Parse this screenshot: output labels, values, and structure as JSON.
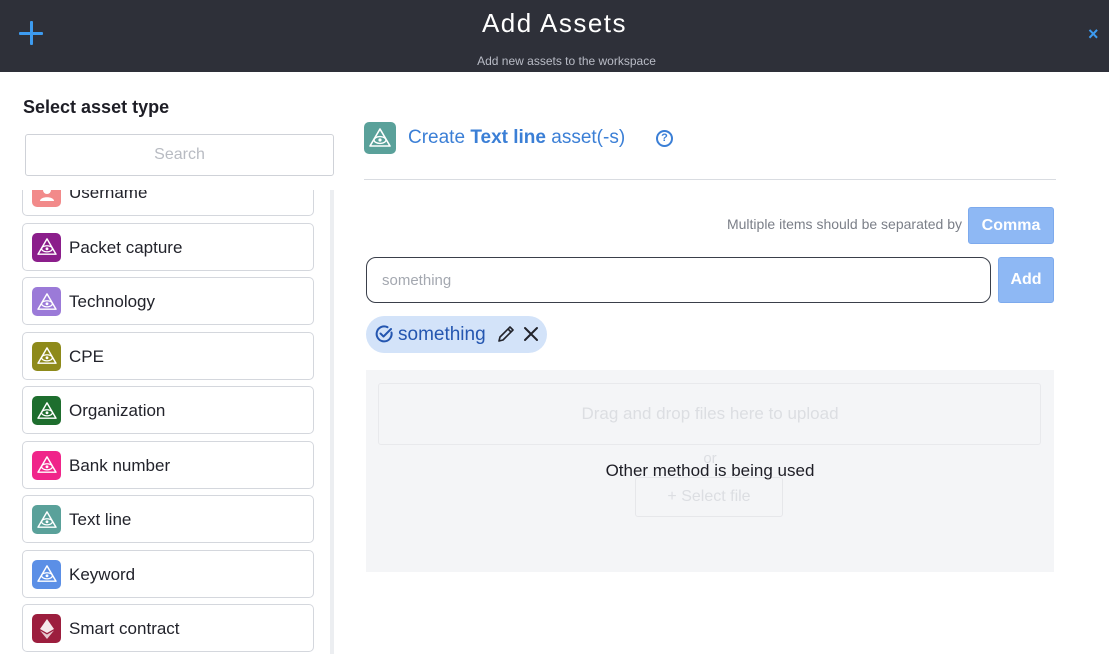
{
  "header": {
    "title": "Add Assets",
    "subtitle": "Add new assets to the workspace",
    "close_icon": "×"
  },
  "sidebar": {
    "title": "Select asset type",
    "search_placeholder": "Search",
    "items": [
      {
        "label": "Username",
        "icon": "person-icon",
        "color": "#f28a8a"
      },
      {
        "label": "Packet capture",
        "icon": "eye-icon",
        "color": "#8b1e8b"
      },
      {
        "label": "Technology",
        "icon": "eye-icon",
        "color": "#9b7ad8"
      },
      {
        "label": "CPE",
        "icon": "eye-icon",
        "color": "#8e8a1a"
      },
      {
        "label": "Organization",
        "icon": "eye-icon",
        "color": "#1e6e2e"
      },
      {
        "label": "Bank number",
        "icon": "eye-icon",
        "color": "#f0258a"
      },
      {
        "label": "Text line",
        "icon": "eye-icon",
        "color": "#5aa19a"
      },
      {
        "label": "Keyword",
        "icon": "eye-icon",
        "color": "#5b8fe6"
      },
      {
        "label": "Smart contract",
        "icon": "ethereum-icon",
        "color": "#9c1e3e"
      }
    ]
  },
  "main": {
    "create_prefix": "Create",
    "asset_type": "Text line",
    "create_suffix": "asset(-s)",
    "separator_label": "Multiple items should be separated by",
    "separator_button": "Comma",
    "input_placeholder": "something",
    "add_button": "Add",
    "chips": [
      {
        "text": "something"
      }
    ],
    "upload": {
      "drag_text": "Drag and drop files here to upload",
      "or_text": "or",
      "select_file": "Select file",
      "overlay_text": "Other method is being used"
    }
  },
  "colors": {
    "header_bg": "#2e3039",
    "accent": "#3b7fd6",
    "button_bg": "#8eb8f4",
    "chip_bg": "#d3e3f9"
  }
}
